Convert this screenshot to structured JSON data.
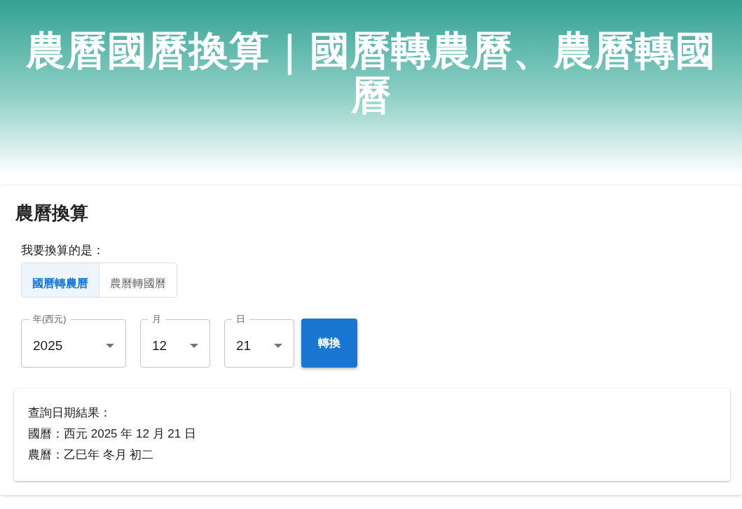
{
  "header": {
    "title": "農曆國曆換算｜國曆轉農曆、農曆轉國曆"
  },
  "converter": {
    "heading": "農曆換算",
    "prompt": "我要換算的是：",
    "modes": [
      {
        "label": "國曆轉農曆",
        "selected": true
      },
      {
        "label": "農曆轉國曆",
        "selected": false
      }
    ],
    "selects": [
      {
        "label": "年(西元)",
        "value": "2025"
      },
      {
        "label": "月",
        "value": "12"
      },
      {
        "label": "日",
        "value": "21"
      }
    ],
    "button": "轉換",
    "result": {
      "lines": [
        "查詢日期結果：",
        "國曆：西元 2025 年 12 月 21 日",
        "農曆：乙巳年 冬月 初二"
      ]
    }
  }
}
